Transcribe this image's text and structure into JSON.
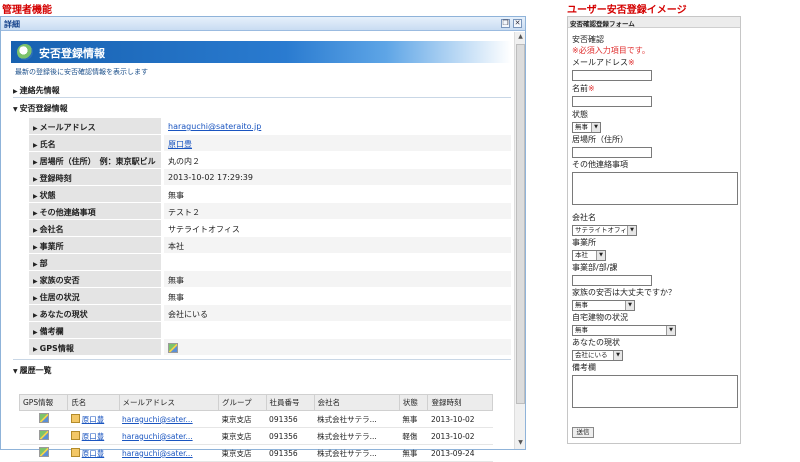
{
  "labels": {
    "left": "管理者機能",
    "right": "ユーザー安否登録イメージ"
  },
  "window": {
    "title": "詳細",
    "restore_icon": "restore-icon",
    "close_icon": "close-icon"
  },
  "banner": {
    "title": "安否登録情報",
    "description": "最新の登録後に安否確認情報を表示します"
  },
  "sections": {
    "contact": "連絡先情報",
    "safety": "安否登録情報",
    "history": "履歴一覧"
  },
  "detail_rows": [
    {
      "label": "メールアドレス",
      "value": "haraguchi@sateraito.jp",
      "link": true
    },
    {
      "label": "氏名",
      "value": "原口豊",
      "link": true
    },
    {
      "label": "居場所（住所）　例：東京駅ビル",
      "value": "丸の内２",
      "link": false
    },
    {
      "label": "登録時刻",
      "value": "2013-10-02 17:29:39",
      "link": false
    },
    {
      "label": "状態",
      "value": "無事",
      "link": false
    },
    {
      "label": "その他連絡事項",
      "value": "テスト２",
      "link": false
    },
    {
      "label": "会社名",
      "value": "サテライトオフィス",
      "link": false
    },
    {
      "label": "事業所",
      "value": "本社",
      "link": false
    },
    {
      "label": "部",
      "value": "",
      "link": false
    },
    {
      "label": "家族の安否",
      "value": "無事",
      "link": false
    },
    {
      "label": "住居の状況",
      "value": "無事",
      "link": false
    },
    {
      "label": "あなたの現状",
      "value": "会社にいる",
      "link": false
    },
    {
      "label": "備考欄",
      "value": "",
      "link": false
    },
    {
      "label": "GPS情報",
      "value": "",
      "link": false
    }
  ],
  "history": {
    "columns": [
      "GPS情報",
      "氏名",
      "メールアドレス",
      "グループ",
      "社員番号",
      "会社名",
      "状態",
      "登録時刻"
    ],
    "rows": [
      [
        "",
        "原口豊",
        "haraguchi@sater...",
        "東京支店",
        "091356",
        "株式会社サテラ...",
        "無事",
        "2013-10-02"
      ],
      [
        "",
        "原口豊",
        "haraguchi@sater...",
        "東京支店",
        "091356",
        "株式会社サテラ...",
        "軽傷",
        "2013-10-02"
      ],
      [
        "",
        "原口豊",
        "haraguchi@sater...",
        "東京支店",
        "091356",
        "株式会社サテラ...",
        "無事",
        "2013-09-24"
      ]
    ]
  },
  "form": {
    "header": "安否確認登録フォーム",
    "title": "安否確認",
    "required_note": "※必須入力項目です。",
    "email_label": "メールアドレス",
    "required_mark": "※",
    "name_label": "名前",
    "status_label": "状態",
    "status_value": "無事",
    "location_label": "居場所（住所）",
    "other_label": "その他連絡事項",
    "company_label": "会社名",
    "company_value": "サテライトオフィス",
    "office_label": "事業所",
    "office_value": "本社",
    "dept_label": "事業部/部/課",
    "family_label": "家族の安否は大丈夫ですか？",
    "family_value": "無事",
    "home_label": "自宅建物の状況",
    "home_value": "無事",
    "current_label": "あなたの現状",
    "current_value": "会社にいる",
    "remarks_label": "備考欄",
    "submit": "送信"
  }
}
